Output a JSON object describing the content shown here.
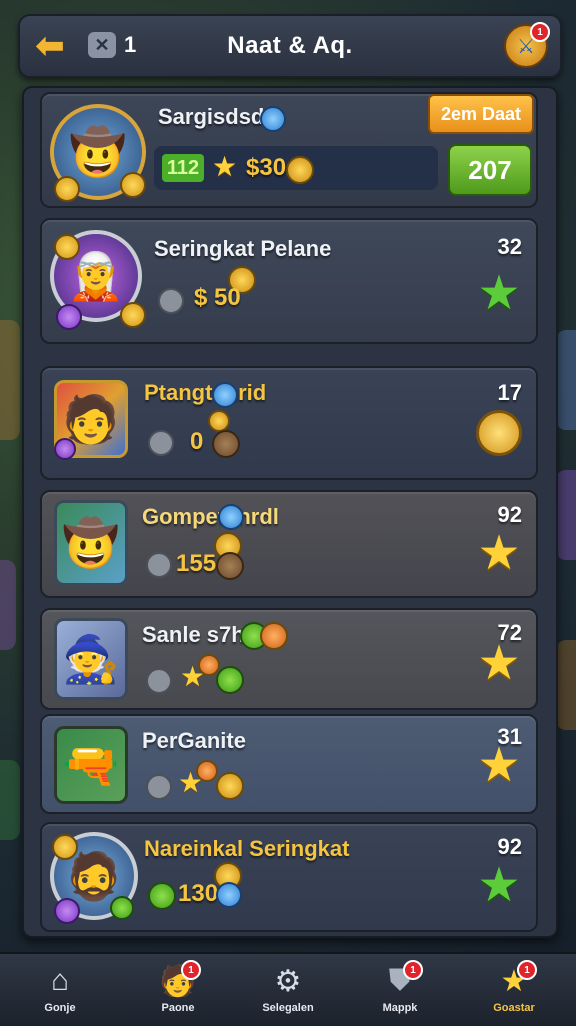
{
  "header": {
    "title": "Naat & Aq.",
    "tool_count": "1",
    "tool_glyph": "✕",
    "back_glyph": "⬅"
  },
  "player": {
    "name": "Sargisdsde",
    "level": "112",
    "currency": "$30",
    "badge_button": "2em Daat",
    "score": "207"
  },
  "rows": [
    {
      "name": "Seringkat Pelane",
      "score": "32",
      "amount": "$ 50",
      "reward": "green-star-icon"
    },
    {
      "name": "Ptangt Inrid",
      "score": "17",
      "amount": "0",
      "reward": "gold-coin-icon"
    },
    {
      "name": "Gompet Inrdl",
      "score": "92",
      "amount": "155",
      "reward": "gold-star-icon"
    },
    {
      "name": "Sanle s7h",
      "score": "72",
      "amount": "",
      "reward": "gold-star-icon"
    },
    {
      "name": "PerGanite",
      "score": "31",
      "amount": "",
      "reward": "gold-star-icon"
    },
    {
      "name": "Nareinkal Seringkat",
      "score": "92",
      "amount": "130",
      "reward": "green-star-icon"
    }
  ],
  "nav": [
    {
      "label": "Gonje",
      "icon": "home-icon"
    },
    {
      "label": "Paone",
      "icon": "hero-icon",
      "notif": "1"
    },
    {
      "label": "Selegalen",
      "icon": "settings-icon"
    },
    {
      "label": "Mappk",
      "icon": "shield-icon",
      "notif": "1"
    },
    {
      "label": "Goastar",
      "icon": "star-icon",
      "notif": "1"
    }
  ],
  "colors": {
    "accent_gold": "#f5c542",
    "button_orange": "#f2a623",
    "button_green": "#6fbf2c",
    "panel": "#2c3444"
  }
}
